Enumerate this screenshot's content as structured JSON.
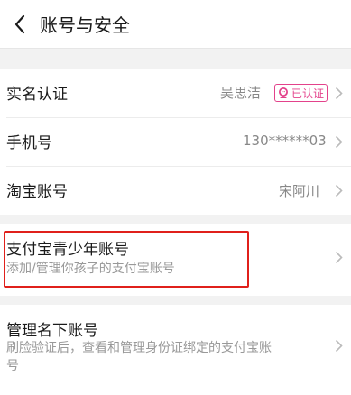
{
  "header": {
    "title": "账号与安全"
  },
  "identity": {
    "label": "实名认证",
    "value": "吴思洁",
    "badge": "已认证"
  },
  "phone": {
    "label": "手机号",
    "value": "130******03"
  },
  "taobao": {
    "label": "淘宝账号",
    "value": "宋阿川"
  },
  "teen": {
    "label": "支付宝青少年账号",
    "description": "添加/管理你孩子的支付宝账号"
  },
  "manage": {
    "label": "管理名下账号",
    "description_line1": "刷脸验证后，查看和管理身份证绑定的支付宝账",
    "description_line2": "号"
  },
  "colors": {
    "accent": "#e3428b",
    "highlight": "#e0201b"
  }
}
